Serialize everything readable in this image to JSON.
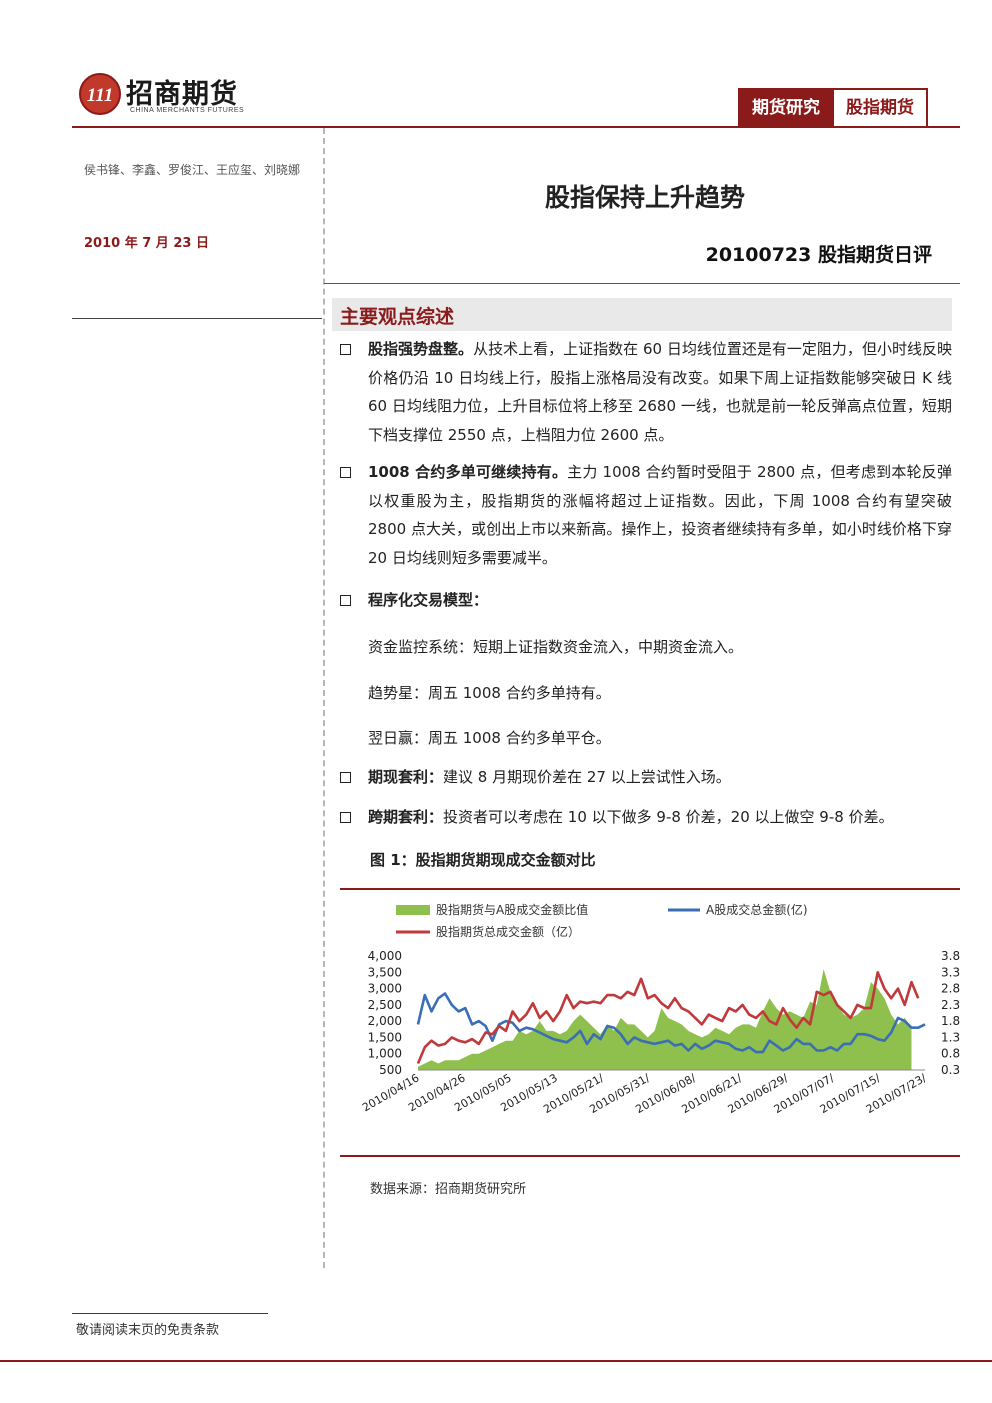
{
  "brand": {
    "name_cn": "招商期货",
    "name_en": "CHINA MERCHANTS FUTURES",
    "logo_mark": "111"
  },
  "header_tags": [
    "期货研究",
    "股指期货"
  ],
  "sidebar": {
    "authors": "侯书锋、李鑫、罗俊江、王应玺、刘晓娜",
    "date": "2010 年 7 月 23 日"
  },
  "title": "股指保持上升趋势",
  "subtitle": "20100723 股指期货日评",
  "section_title": "主要观点综述",
  "bullets": [
    {
      "lead": "股指强势盘整。",
      "text": "从技术上看，上证指数在 60 日均线位置还是有一定阻力，但小时线反映价格仍沿 10 日均线上行，股指上涨格局没有改变。如果下周上证指数能够突破日 K 线 60 日均线阻力位，上升目标位将上移至 2680 一线，也就是前一轮反弹高点位置，短期下档支撑位 2550 点，上档阻力位 2600 点。"
    },
    {
      "lead": "1008 合约多单可继续持有。",
      "text": "主力 1008 合约暂时受阻于 2800 点，但考虑到本轮反弹以权重股为主，股指期货的涨幅将超过上证指数。因此，下周 1008 合约有望突破 2800 点大关，或创出上市以来新高。操作上，投资者继续持有多单，如小时线价格下穿 20 日均线则短多需要减半。"
    },
    {
      "lead": "程序化交易模型：",
      "text": ""
    }
  ],
  "model_lines": [
    "资金监控系统：短期上证指数资金流入，中期资金流入。",
    "趋势星：周五 1008 合约多单持有。",
    "翌日赢：周五 1008 合约多单平仓。"
  ],
  "arbitrage": [
    {
      "lead": "期现套利：",
      "text": "建议 8 月期现价差在 27 以上尝试性入场。"
    },
    {
      "lead": "跨期套利：",
      "text": "投资者可以考虑在 10 以下做多 9-8 价差，20 以上做空 9-8 价差。"
    }
  ],
  "figure_title": "图 1：股指期货期现成交金额对比",
  "source": "数据来源：招商期货研究所",
  "footer_note": "敬请阅读末页的免责条款",
  "colors": {
    "brand": "#8b1a1a",
    "area": "#8fbf4c",
    "line_blue": "#3a6eb5",
    "line_red": "#c0393b"
  },
  "chart_data": {
    "type": "line",
    "legend": [
      "股指期货与A股成交金额比值",
      "A股成交总金额(亿)",
      "股指期货总成交金额（亿）"
    ],
    "y_left_ticks": [
      "4,000",
      "3,500",
      "3,000",
      "2,500",
      "2,000",
      "1,500",
      "1,000",
      "500"
    ],
    "y_right_ticks": [
      "3.8",
      "3.3",
      "2.8",
      "2.3",
      "1.8",
      "1.3",
      "0.8",
      "0.3"
    ],
    "ylim_left": [
      500,
      4000
    ],
    "ylim_right": [
      0.3,
      3.8
    ],
    "x_ticks": [
      "2010/04/16",
      "2010/04/26",
      "2010/05/05",
      "2010/05/13",
      "2010/05/21/",
      "2010/05/31/",
      "2010/06/08/",
      "2010/06/21/",
      "2010/06/29/",
      "2010/07/07/",
      "2010/07/15/",
      "2010/07/23/"
    ],
    "series": [
      {
        "name": "股指期货与A股成交金额比值",
        "kind": "area",
        "values": [
          0.4,
          0.5,
          0.6,
          0.5,
          0.6,
          0.6,
          0.6,
          0.7,
          0.8,
          0.8,
          0.9,
          1.0,
          1.1,
          1.2,
          1.2,
          1.5,
          1.4,
          1.5,
          1.8,
          1.5,
          1.5,
          1.4,
          1.5,
          1.8,
          2.0,
          1.8,
          1.6,
          1.4,
          1.7,
          1.5,
          1.9,
          1.7,
          1.7,
          1.5,
          1.3,
          1.5,
          2.2,
          1.9,
          1.8,
          1.7,
          1.5,
          1.4,
          1.3,
          1.4,
          1.6,
          1.5,
          1.4,
          1.6,
          1.7,
          1.7,
          1.6,
          2.1,
          2.5,
          2.2,
          2.0,
          2.1,
          2.0,
          1.9,
          2.4,
          2.3,
          3.4,
          2.7,
          2.3,
          2.0,
          1.9,
          2.0,
          2.2,
          3.0,
          2.8,
          2.5,
          2.0,
          1.7,
          1.9,
          1.6
        ]
      },
      {
        "name": "A股成交总金额(亿)",
        "kind": "line",
        "values": [
          1900,
          2800,
          2300,
          2700,
          2850,
          2500,
          2300,
          2400,
          1900,
          2000,
          1850,
          1400,
          1900,
          2000,
          1950,
          1700,
          1800,
          1750,
          1650,
          1550,
          1450,
          1400,
          1350,
          1500,
          1700,
          1300,
          1600,
          1450,
          1850,
          1800,
          1600,
          1300,
          1500,
          1400,
          1350,
          1300,
          1350,
          1400,
          1250,
          1300,
          1100,
          1300,
          1150,
          1250,
          1400,
          1350,
          1300,
          1150,
          1100,
          1200,
          1050,
          1050,
          1400,
          1250,
          1100,
          1200,
          1450,
          1300,
          1300,
          1100,
          1100,
          1200,
          1100,
          1300,
          1300,
          1600,
          1600,
          1550,
          1450,
          1400,
          1650,
          2100,
          2000,
          1800,
          1800,
          1900
        ]
      },
      {
        "name": "股指期货总成交金额（亿）",
        "kind": "line",
        "values": [
          700,
          1200,
          1400,
          1250,
          1300,
          1500,
          1400,
          1350,
          1450,
          1300,
          1650,
          1600,
          1850,
          1700,
          2300,
          2000,
          2200,
          2550,
          2100,
          2300,
          2000,
          2300,
          2800,
          2400,
          2600,
          2550,
          2600,
          2550,
          2800,
          2800,
          2700,
          2900,
          2800,
          3300,
          2700,
          2800,
          2550,
          2400,
          2700,
          2400,
          2300,
          2100,
          1900,
          2200,
          2100,
          2000,
          2400,
          2300,
          2500,
          2200,
          2100,
          2300,
          2000,
          1900,
          2400,
          2050,
          1800,
          2100,
          1900,
          2900,
          2800,
          2900,
          2500,
          2300,
          2100,
          2500,
          2400,
          2400,
          3500,
          3000,
          2700,
          3000,
          2500,
          3200,
          2700
        ]
      }
    ]
  }
}
